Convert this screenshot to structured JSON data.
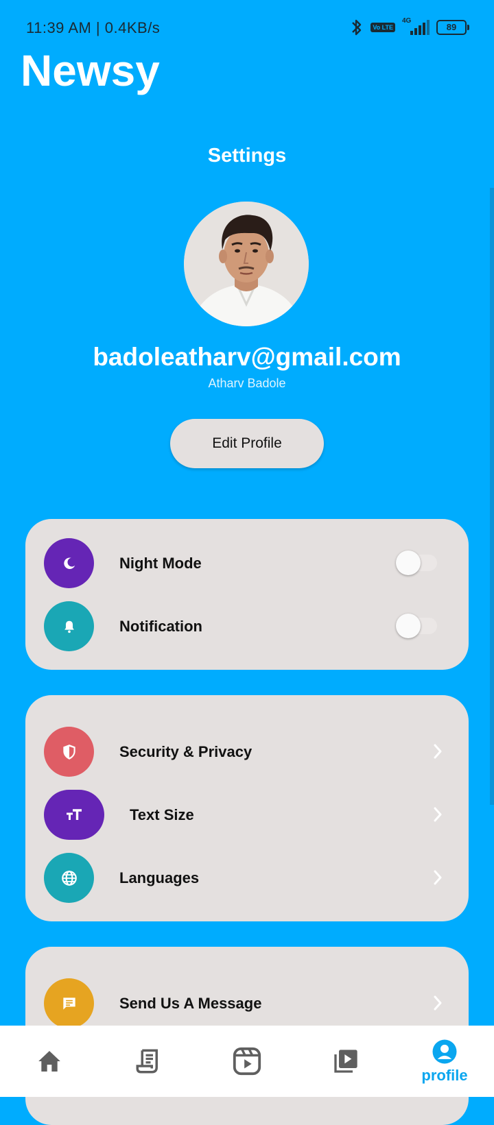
{
  "status_bar": {
    "time": "11:39 AM | 0.4KB/s",
    "network": "4G",
    "volte": "Vo LTE",
    "battery": "89"
  },
  "app": {
    "title": "Newsy"
  },
  "page": {
    "title": "Settings"
  },
  "profile": {
    "email": "badoleatharv@gmail.com",
    "name": "Atharv Badole",
    "edit_label": "Edit Profile"
  },
  "toggles": [
    {
      "label": "Night Mode",
      "icon": "moon-icon",
      "color": "#6525b5",
      "on": false
    },
    {
      "label": "Notification",
      "icon": "bell-icon",
      "color": "#1aa7b5",
      "on": false
    }
  ],
  "preferences": [
    {
      "label": "Security & Privacy",
      "icon": "shield-icon",
      "color": "#df5d65"
    },
    {
      "label": "Text Size",
      "icon": "text-size-icon",
      "color": "#6525b5"
    },
    {
      "label": "Languages",
      "icon": "globe-icon",
      "color": "#1aa7b5"
    }
  ],
  "support": [
    {
      "label": "Send Us A Message",
      "icon": "message-icon",
      "color": "#e6a421"
    }
  ],
  "bottom_nav": [
    {
      "icon": "home-icon",
      "label": ""
    },
    {
      "icon": "articles-icon",
      "label": ""
    },
    {
      "icon": "reels-icon",
      "label": ""
    },
    {
      "icon": "video-library-icon",
      "label": ""
    },
    {
      "icon": "profile-icon",
      "label": "profile",
      "active": true
    }
  ],
  "colors": {
    "background": "#00acfe",
    "card": "#e4e0df",
    "nav_active": "#0aa6ef",
    "nav_inactive": "#5f5f5f"
  }
}
